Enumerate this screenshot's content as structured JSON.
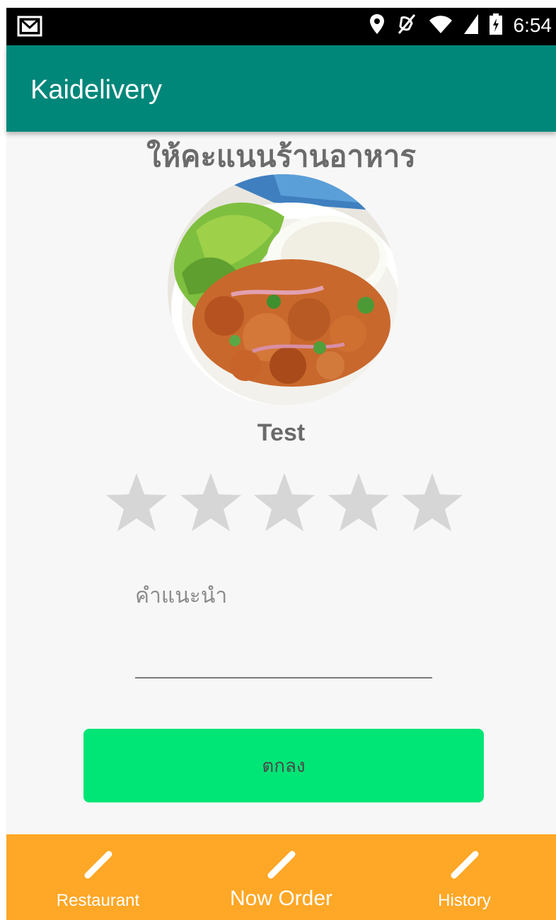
{
  "status_bar": {
    "time": "6:54",
    "icons": [
      "gmail-icon",
      "location-icon",
      "mute-icon",
      "wifi-icon",
      "signal-icon",
      "battery-charging-icon"
    ]
  },
  "app_bar": {
    "title": "Kaidelivery",
    "color": "#00877a"
  },
  "rating": {
    "heading": "ให้คะแนนร้านอาหาร",
    "restaurant_name": "Test",
    "max_stars": 5,
    "selected_stars": 0,
    "star_color": "#d6d6d6",
    "comment_placeholder": "คำแนะนำ",
    "submit_label": "ตกลง",
    "submit_color": "#00e676"
  },
  "bottom_nav": {
    "color": "#ffa726",
    "items": [
      {
        "label": "Restaurant",
        "icon": "pencil-icon"
      },
      {
        "label": "Now Order",
        "icon": "pencil-icon"
      },
      {
        "label": "History",
        "icon": "pencil-icon"
      }
    ]
  }
}
